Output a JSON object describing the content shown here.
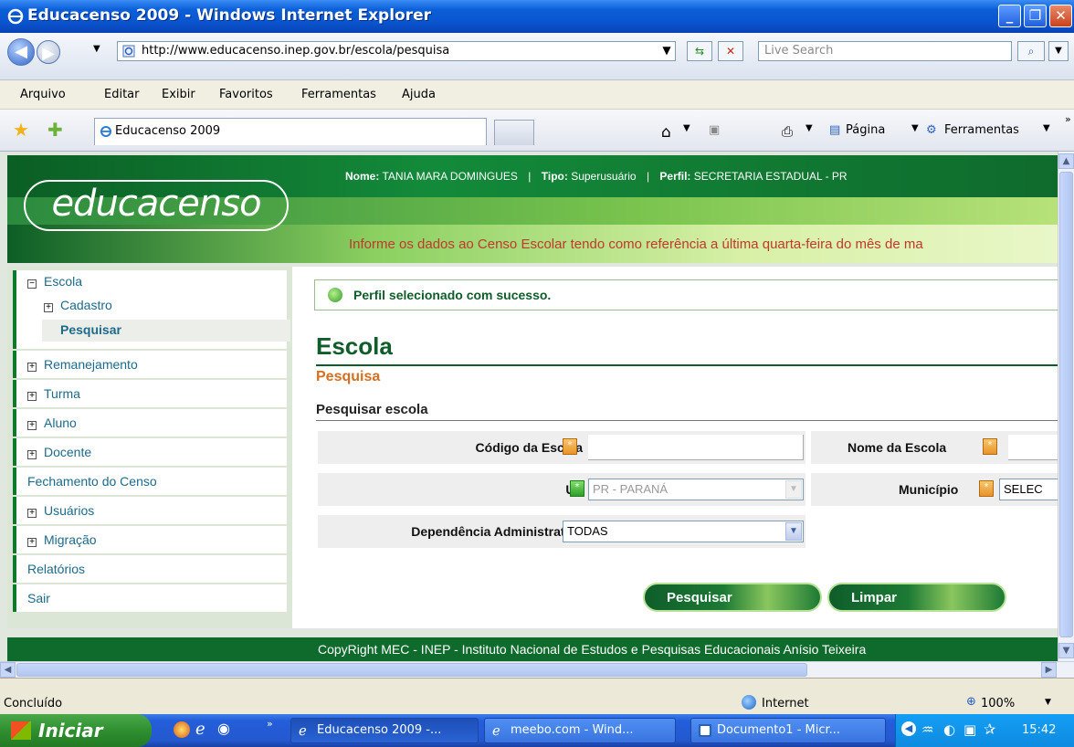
{
  "window": {
    "title": "Educacenso 2009 - Windows Internet Explorer"
  },
  "address_bar": {
    "url": "http://www.educacenso.inep.gov.br/escola/pesquisa",
    "search_placeholder": "Live Search"
  },
  "menu": [
    "Arquivo",
    "Editar",
    "Exibir",
    "Favoritos",
    "Ferramentas",
    "Ajuda"
  ],
  "tabs": {
    "active": "Educacenso 2009"
  },
  "command_bar": {
    "page_label": "Página",
    "tools_label": "Ferramentas"
  },
  "header": {
    "logo": "educacenso",
    "nome_label": "Nome:",
    "nome_value": "TANIA MARA DOMINGUES",
    "tipo_label": "Tipo:",
    "tipo_value": "Superusuário",
    "perfil_label": "Perfil:",
    "perfil_value": "SECRETARIA ESTADUAL - PR",
    "notice": "Informe os dados ao Censo Escolar tendo como referência a última quarta-feira do mês de ma"
  },
  "sidebar": {
    "escola": "Escola",
    "cadastro": "Cadastro",
    "pesquisar": "Pesquisar",
    "items": [
      "Remanejamento",
      "Turma",
      "Aluno",
      "Docente",
      "Fechamento do Censo",
      "Usuários",
      "Migração",
      "Relatórios",
      "Sair"
    ]
  },
  "main": {
    "success_message": "Perfil selecionado com sucesso.",
    "title": "Escola",
    "subtitle": "Pesquisa",
    "section": "Pesquisar escola",
    "fields": {
      "codigo_label": "Código da Escola",
      "nome_label": "Nome da Escola",
      "uf_label": "UF",
      "uf_value": "PR - PARANÁ",
      "municipio_label": "Município",
      "municipio_value": "SELEC",
      "dependencia_label": "Dependência Administrativa",
      "dependencia_value": "TODAS"
    },
    "buttons": {
      "search": "Pesquisar",
      "clear": "Limpar"
    }
  },
  "footer": "CopyRight MEC - INEP - Instituto Nacional de Estudos e Pesquisas Educacionais Anísio Teixeira",
  "status": {
    "text": "Concluído",
    "zone": "Internet",
    "zoom": "100%"
  },
  "taskbar": {
    "start": "Iniciar",
    "items": [
      "Educacenso 2009 -...",
      "meebo.com - Wind...",
      "Documento1 - Micr..."
    ],
    "clock": "15:42"
  },
  "colors": {
    "brand_green": "#0f5d2a",
    "accent_orange": "#d47020",
    "xp_blue": "#0a54cf"
  }
}
